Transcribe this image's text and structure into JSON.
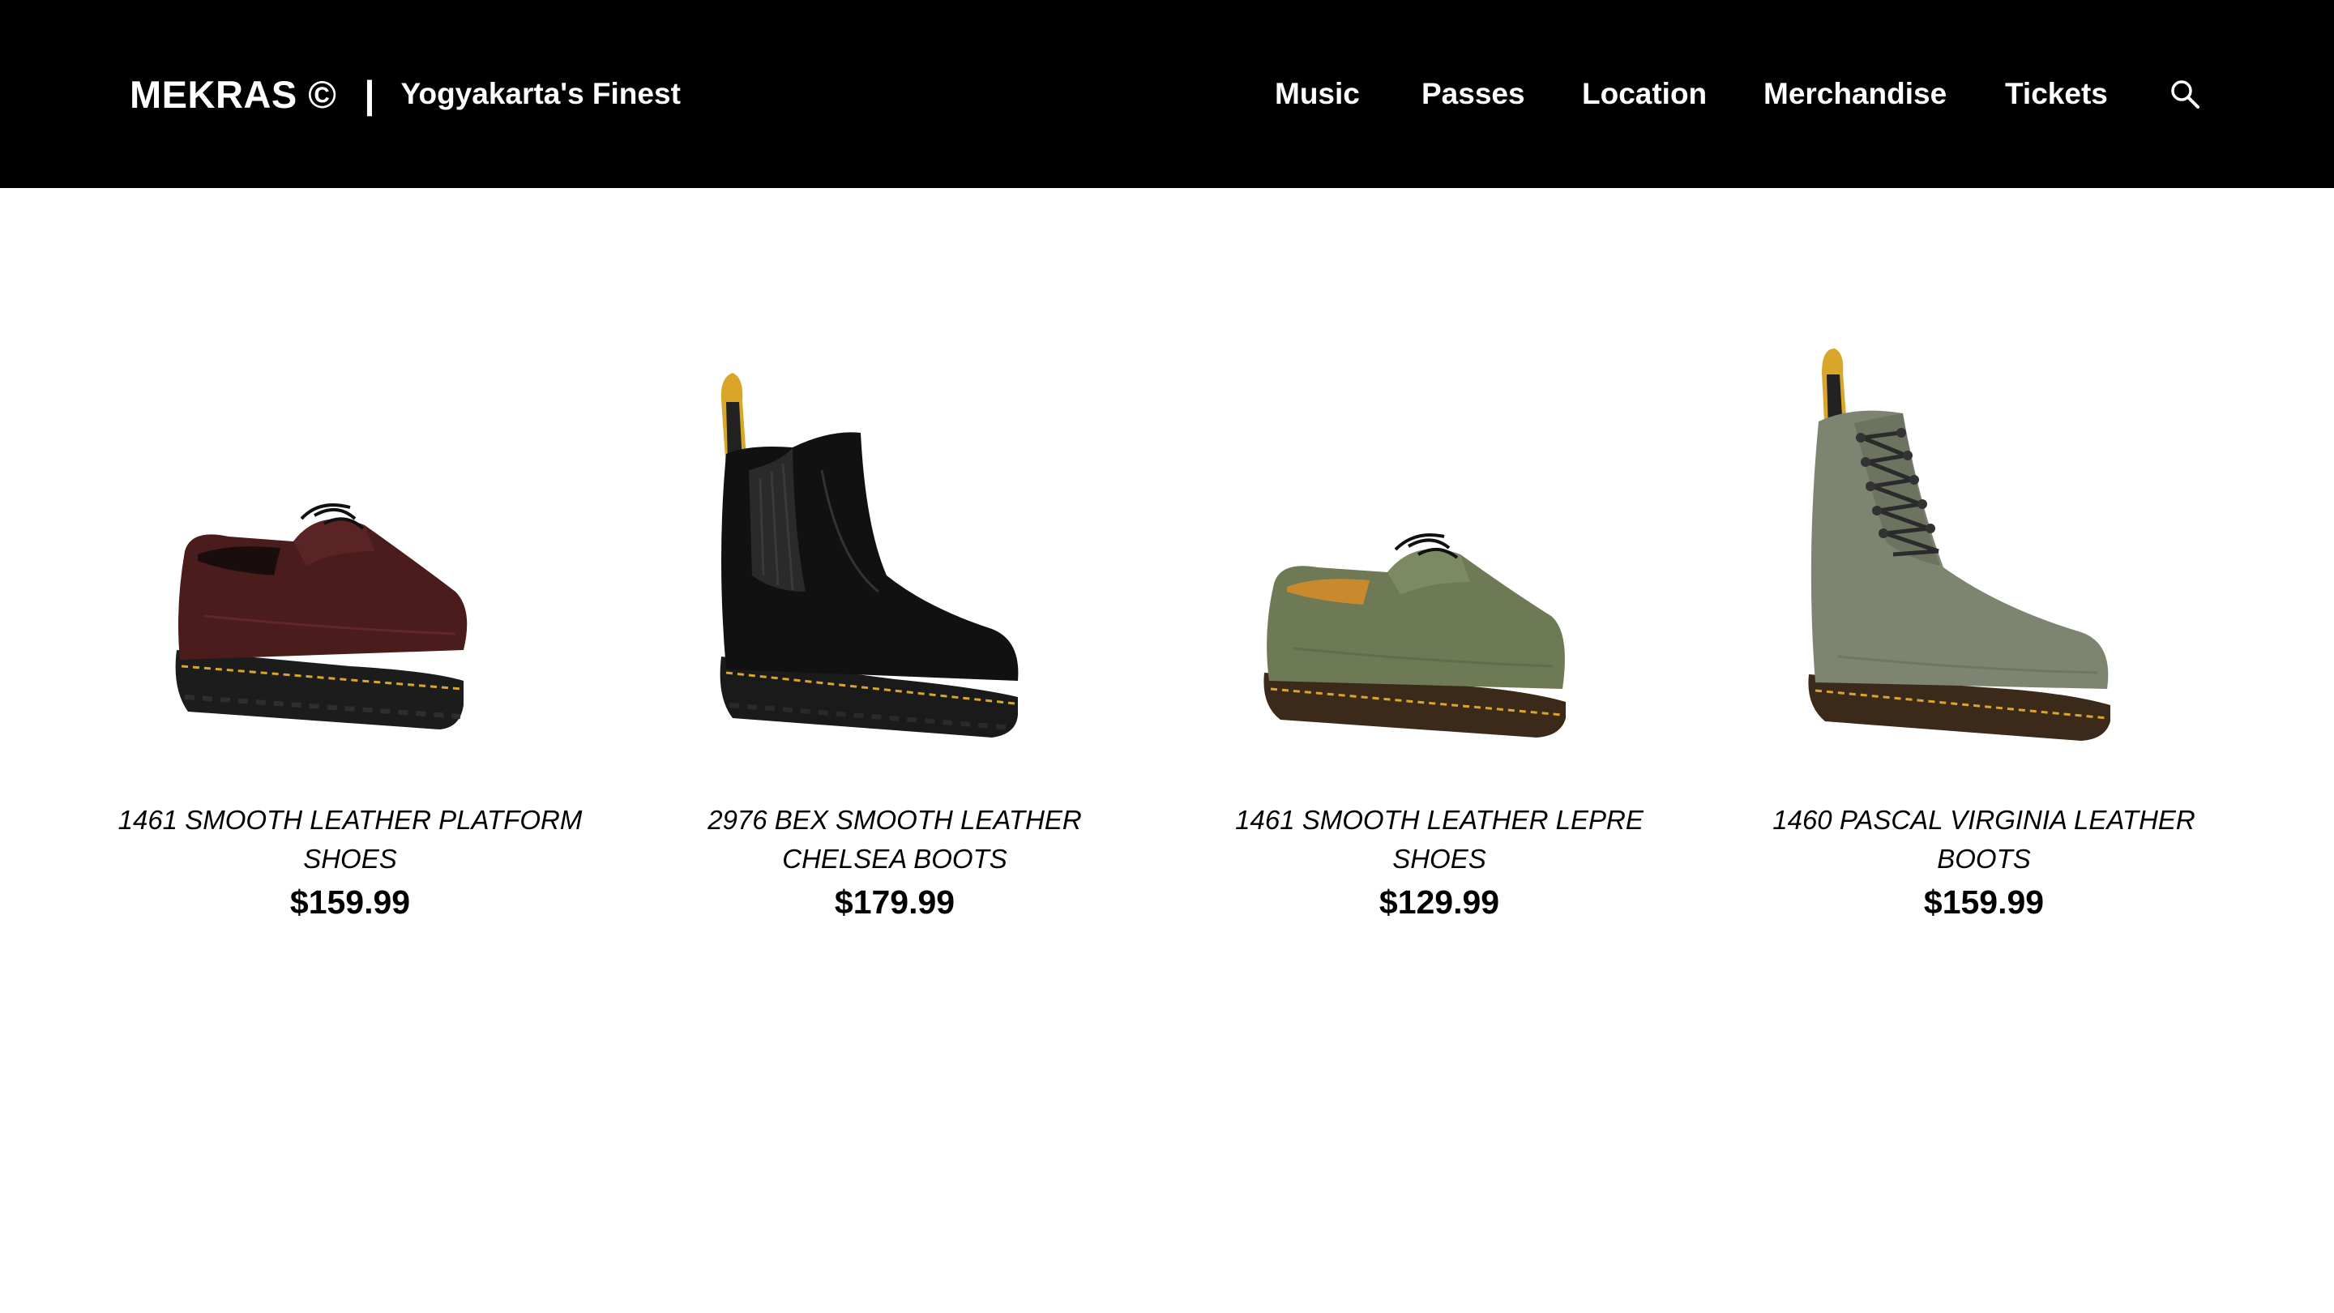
{
  "header": {
    "brand_name": "MEKRAS ©",
    "separator": "|",
    "tagline": "Yogyakarta's Finest",
    "nav": [
      {
        "label": "Music"
      },
      {
        "label": "Passes"
      },
      {
        "label": "Location"
      },
      {
        "label": "Merchandise"
      },
      {
        "label": "Tickets"
      }
    ],
    "search_icon": "search-icon"
  },
  "products": [
    {
      "name": "1461 SMOOTH LEATHER PLATFORM SHOES",
      "price": "$159.99",
      "image": "oxblood-platform-shoe",
      "color": "#4a1c1c"
    },
    {
      "name": "2976 BEX SMOOTH LEATHER CHELSEA BOOTS",
      "price": "$179.99",
      "image": "black-chelsea-boot",
      "color": "#111111"
    },
    {
      "name": "1461 SMOOTH LEATHER LEPRE SHOES",
      "price": "$129.99",
      "image": "green-derby-shoe",
      "color": "#6e7a55"
    },
    {
      "name": "1460 PASCAL VIRGINIA LEATHER BOOTS",
      "price": "$159.99",
      "image": "grey-green-lace-boot",
      "color": "#7d8470"
    }
  ],
  "colors": {
    "header_bg": "#000000",
    "stitch": "#d9a62a"
  }
}
